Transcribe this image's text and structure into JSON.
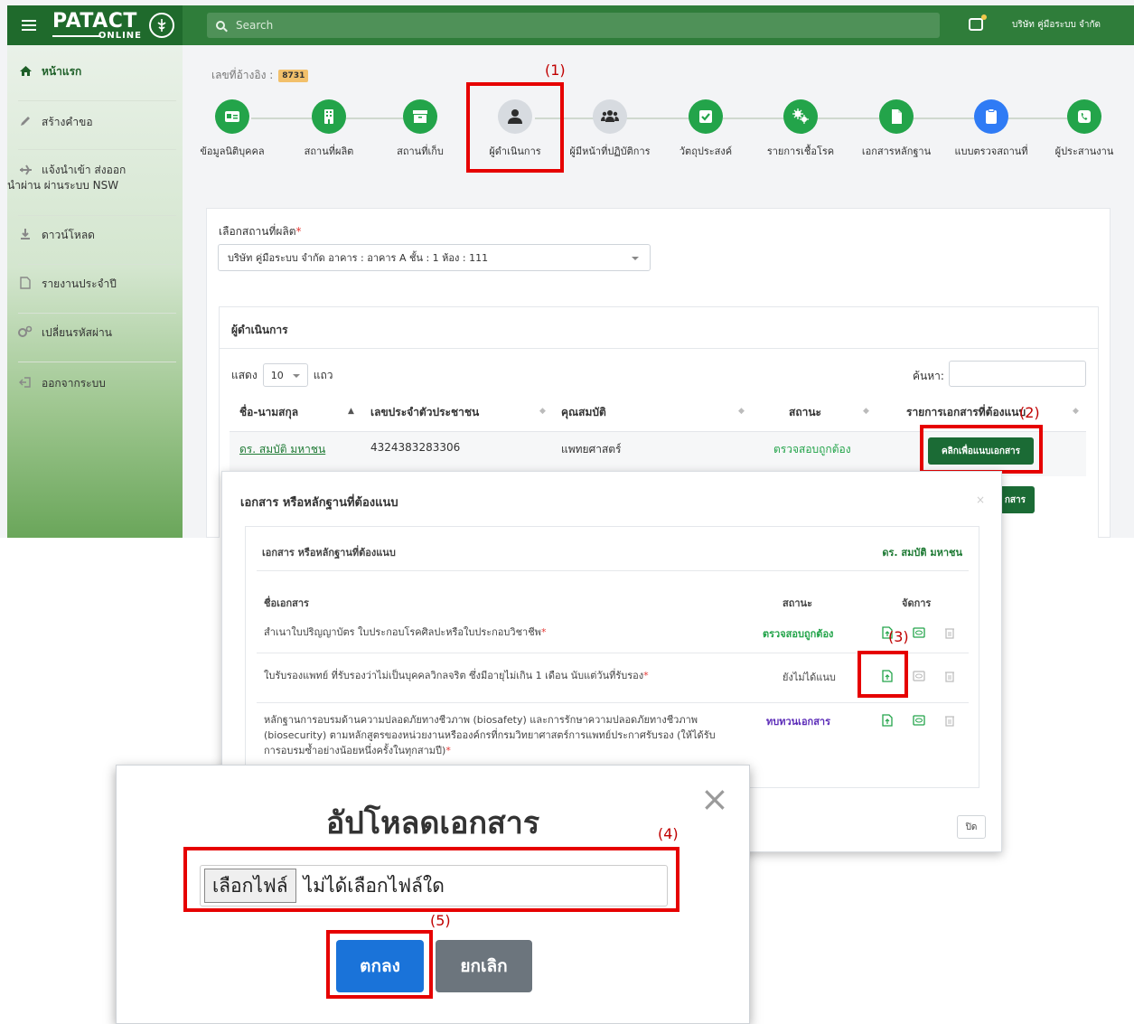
{
  "header": {
    "logo_text": "PATACT",
    "logo_subtext": "ONLINE",
    "search_placeholder": "Search",
    "user_name": "บริษัท คู่มือระบบ จำกัด"
  },
  "sidebar": {
    "items": [
      {
        "label": "หน้าแรก",
        "icon": "home-icon"
      },
      {
        "label": "สร้างคำขอ",
        "icon": "pencil-icon"
      },
      {
        "label": "แจ้งนำเข้า ส่งออก นำผ่าน ผ่านระบบ NSW",
        "icon": "plane-icon"
      },
      {
        "label": "ดาวน์โหลด",
        "icon": "download-icon"
      },
      {
        "label": "รายงานประจำปี",
        "icon": "file-icon"
      },
      {
        "label": "เปลี่ยนรหัสผ่าน",
        "icon": "gears-icon"
      },
      {
        "label": "ออกจากระบบ",
        "icon": "logout-icon"
      }
    ]
  },
  "reference": {
    "label": "เลขที่อ้างอิง :",
    "value": "8731"
  },
  "steps": [
    {
      "label": "ข้อมูลนิติบุคคล",
      "icon": "id-card-icon"
    },
    {
      "label": "สถานที่ผลิต",
      "icon": "building-icon"
    },
    {
      "label": "สถานที่เก็บ",
      "icon": "archive-icon"
    },
    {
      "label": "ผู้ดำเนินการ",
      "icon": "user-icon"
    },
    {
      "label": "ผู้มีหน้าที่ปฏิบัติการ",
      "icon": "users-icon"
    },
    {
      "label": "วัตถุประสงค์",
      "icon": "check-icon"
    },
    {
      "label": "รายการเชื้อโรค",
      "icon": "virus-icon"
    },
    {
      "label": "เอกสารหลักฐาน",
      "icon": "document-icon"
    },
    {
      "label": "แบบตรวจสถานที่",
      "icon": "clipboard-icon"
    },
    {
      "label": "ผู้ประสานงาน",
      "icon": "phone-icon"
    }
  ],
  "production": {
    "label": "เลือกสถานที่ผลิต",
    "required_mark": "*",
    "selected": "บริษัท คู่มือระบบ จำกัด อาคาร : อาคาร A ชั้น : 1 ห้อง : 111"
  },
  "operators": {
    "title": "ผู้ดำเนินการ",
    "show_label": "แสดง",
    "show_value": "10",
    "rows_label": "แถว",
    "search_label": "ค้นหา:",
    "columns": [
      "ชื่อ-นามสกุล",
      "เลขประจำตัวประชาชน",
      "คุณสมบัติ",
      "สถานะ",
      "รายการเอกสารที่ต้องแนบ"
    ],
    "row": {
      "name": "ดร. สมบัติ มหาชน",
      "id": "4324383283306",
      "qualification": "แพทยศาสตร์",
      "status": "ตรวจสอบถูกต้อง",
      "attach_button": "คลิกเพื่อแนบเอกสาร"
    },
    "hidden_button_tail": "กสาร"
  },
  "doc_modal": {
    "title": "เอกสาร หรือหลักฐานที่ต้องแนบ",
    "close_x": "×",
    "inner_title": "เอกสาร หรือหลักฐานที่ต้องแนบ",
    "person": "ดร. สมบัติ มหาชน",
    "columns": [
      "ชื่อเอกสาร",
      "สถานะ",
      "จัดการ"
    ],
    "rows": [
      {
        "name": "สำเนาใบปริญญาบัตร ใบประกอบโรคศิลปะหรือใบประกอบวิชาชีพ",
        "req": "*",
        "status": "ตรวจสอบถูกต้อง",
        "status_color": "#23a44a"
      },
      {
        "name": "ใบรับรองแพทย์ ที่รับรองว่าไม่เป็นบุคคลวิกลจริต ซึ่งมีอายุไม่เกิน 1 เดือน นับแต่วันที่รับรอง",
        "req": "*",
        "status": "ยังไม่ได้แนบ",
        "status_color": "#444444"
      },
      {
        "name": "หลักฐานการอบรมด้านความปลอดภัยทางชีวภาพ (biosafety) และการรักษาความปลอดภัยทางชีวภาพ (biosecurity) ตามหลักสูตรของหน่วยงานหรือองค์กรที่กรมวิทยาศาสตร์การแพทย์ประกาศรับรอง (ให้ได้รับการอบรมซ้ำอย่างน้อยหนึ่งครั้งในทุกสามปี)",
        "req": "*",
        "status": "ทบทวนเอกสาร",
        "status_color": "#5b2bb8"
      }
    ],
    "close_button": "ปิด"
  },
  "upload_modal": {
    "title": "อัปโหลดเอกสาร",
    "close_x": "×",
    "file_button": "เลือกไฟล์",
    "file_text": "ไม่ได้เลือกไฟล์ใด",
    "ok_button": "ตกลง",
    "cancel_button": "ยกเลิก"
  },
  "annotations": [
    "(1)",
    "(2)",
    "(3)",
    "(4)",
    "(5)"
  ],
  "colors": {
    "header_green": "#2f7d3a",
    "step_green": "#23a44a",
    "step_blue": "#2f7bf5",
    "highlight_red": "#e60000",
    "ok_blue": "#1a73d9"
  }
}
